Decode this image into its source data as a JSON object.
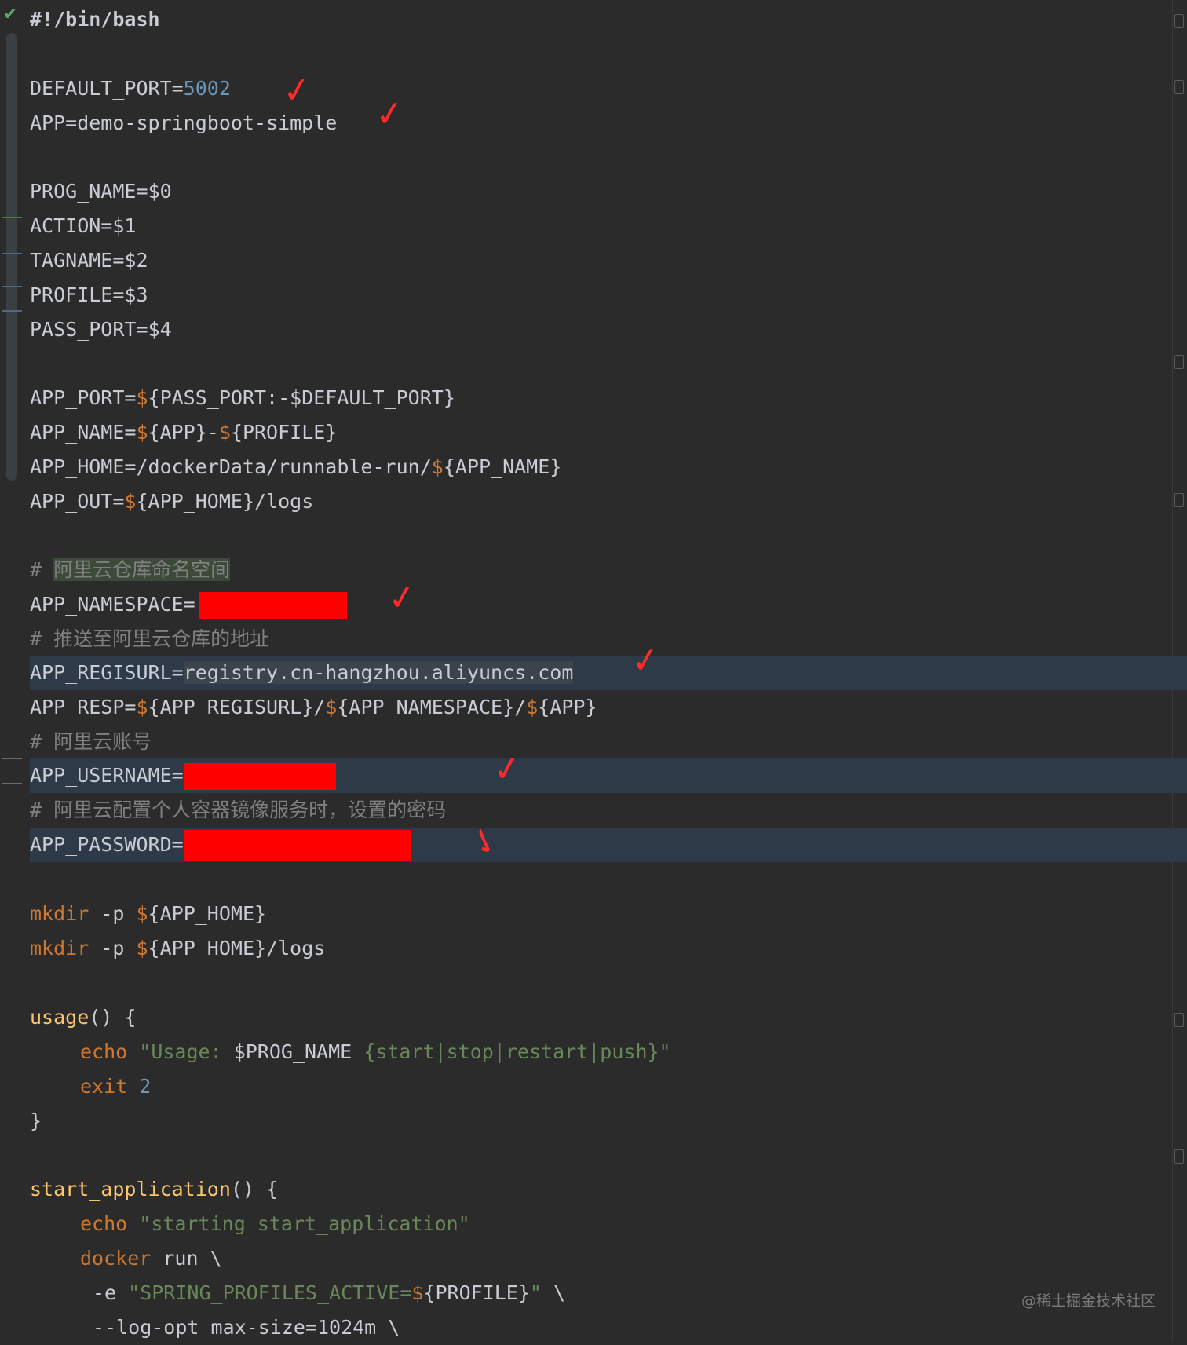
{
  "editor": {
    "status_icon": "check-icon",
    "lines": {
      "shebang": "#!/bin/bash",
      "default_port_key": "DEFAULT_PORT=",
      "default_port_val": "5002",
      "app": "APP=demo-springboot-simple",
      "prog_name": "PROG_NAME=$0",
      "action": "ACTION=$1",
      "tagname": "TAGNAME=$2",
      "profile": "PROFILE=$3",
      "pass_port": "PASS_PORT=$4",
      "app_port_key": "APP_PORT=",
      "app_port_rest": "{PASS_PORT:-$DEFAULT_PORT}",
      "app_name_key": "APP_NAME=",
      "app_name_a": "{APP}-",
      "app_name_b": "{PROFILE}",
      "app_home_key": "APP_HOME=/dockerData/runnable-run/",
      "app_home_rest": "{APP_NAME}",
      "app_out_key": "APP_OUT=",
      "app_out_rest": "{APP_HOME}/logs",
      "cmt_namespace": "阿里云仓库命名空间",
      "app_namespace_key": "APP_NAMESPACE=r",
      "cmt_push": "# 推送至阿里云仓库的地址",
      "app_regisurl_key": "APP_REGISURL=",
      "app_regisurl_val": "registry.cn-hangzhou.aliyuncs.com",
      "app_resp_key": "APP_RESP=",
      "app_resp_a": "{APP_REGISURL}/",
      "app_resp_b": "{APP_NAMESPACE}/",
      "app_resp_c": "{APP}",
      "cmt_account": "# 阿里云账号",
      "app_username_key": "APP_USERNAME=",
      "cmt_password": "# 阿里云配置个人容器镜像服务时，设置的密码",
      "app_password_key": "APP_PASSWORD=",
      "mkdir": "mkdir",
      "mkdir_p": " -p ",
      "mkdir1_rest": "{APP_HOME}",
      "mkdir2_rest": "{APP_HOME}/logs",
      "usage_fn": "usage",
      "usage_rest": "() {",
      "echo": "echo",
      "usage_str1": "\"Usage: ",
      "usage_var": "$PROG_NAME",
      "usage_str2": " {start|stop|restart|push}\"",
      "exit": "exit",
      "exit_code": "2",
      "close_brace": "}",
      "start_fn": "start_application",
      "start_rest": "() {",
      "start_str": "\"starting start_application\"",
      "docker": "docker",
      "docker_rest": " run \\",
      "opt_e": "-e ",
      "opt_e_str1": "\"SPRING_PROFILES_ACTIVE=",
      "opt_e_var": "{PROFILE}",
      "opt_e_str2": "\"",
      "opt_e_tail": " \\",
      "log_opt": "--log-opt max-size=1024m \\"
    }
  },
  "watermark": "@稀土掘金技术社区",
  "colors": {
    "background": "#2b2b2b",
    "keyword": "#cc7832",
    "number": "#6897bb",
    "string": "#6a8759",
    "comment": "#808080",
    "function": "#ffc66d",
    "redaction": "#ff0000",
    "annotation": "#ff2a2a"
  }
}
